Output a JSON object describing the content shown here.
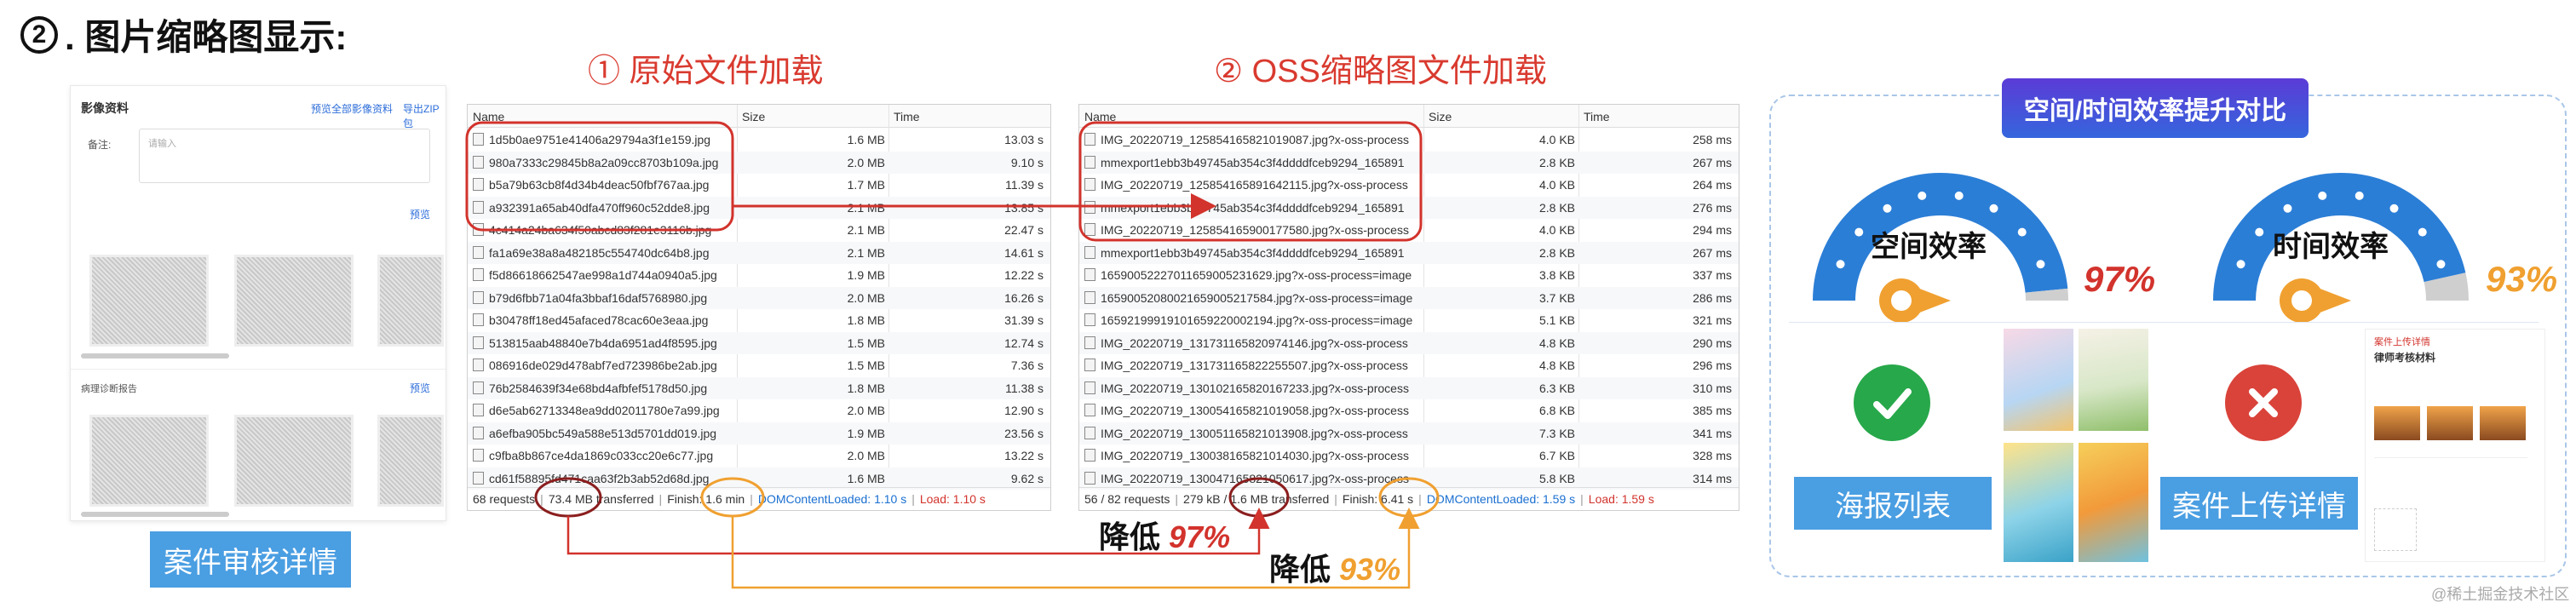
{
  "heading": {
    "num": "2",
    "text": ". 图片缩略图显示:"
  },
  "left_panel": {
    "title": "影像资料",
    "link1": "预览全部影像资料",
    "link2": "导出ZIP包",
    "note_label": "备注:",
    "note_placeholder": "请输入",
    "preview1": "预览",
    "section2": "病理诊断报告",
    "preview2": "预览",
    "button": "案件审核详情"
  },
  "title1": "① 原始文件加载",
  "title2": "② OSS缩略图文件加载",
  "table1": {
    "headers": [
      "Name",
      "Size",
      "Time"
    ],
    "rows": [
      [
        "1d5b0ae9751e41406a29794a3f1e159.jpg",
        "1.6 MB",
        "13.03 s"
      ],
      [
        "980a7333c29845b8a2a09cc8703b109a.jpg",
        "2.0 MB",
        "9.10 s"
      ],
      [
        "b5a79b63cb8f4d34b4deac50fbf767aa.jpg",
        "1.7 MB",
        "11.39 s"
      ],
      [
        "a932391a65ab40dfa470ff960c52dde8.jpg",
        "2.1 MB",
        "13.85 s"
      ],
      [
        "4c414a24ba634f50abcd83f281e3116b.jpg",
        "2.1 MB",
        "22.47 s"
      ],
      [
        "fa1a69e38a8a482185c554740dc64b8.jpg",
        "2.1 MB",
        "14.61 s"
      ],
      [
        "f5d86618662547ae998a1d744a0940a5.jpg",
        "1.9 MB",
        "12.22 s"
      ],
      [
        "b79d6fbb71a04fa3bbaf16daf5768980.jpg",
        "2.0 MB",
        "16.26 s"
      ],
      [
        "b30478ff18ed45afaced78cac60e3eaa.jpg",
        "1.8 MB",
        "31.39 s"
      ],
      [
        "513815aab48840e7b4da6951ad4f8595.jpg",
        "1.5 MB",
        "12.74 s"
      ],
      [
        "086916de029d478abf7ed723986be2ab.jpg",
        "1.5 MB",
        "7.36 s"
      ],
      [
        "76b2584639f34e68bd4afbfef5178d50.jpg",
        "1.8 MB",
        "11.38 s"
      ],
      [
        "d6e5ab62713348ea9dd02011780e7a99.jpg",
        "2.0 MB",
        "12.90 s"
      ],
      [
        "a6efba905bc549a588e513d5701dd019.jpg",
        "1.9 MB",
        "23.56 s"
      ],
      [
        "c9fba8b867ce4da1869c033cc20e6c77.jpg",
        "2.0 MB",
        "13.22 s"
      ],
      [
        "cd61f58895fd471caa63f2b3ab52d68d.jpg",
        "1.6 MB",
        "9.62 s"
      ]
    ],
    "foot_requests": "68 requests",
    "foot_size": "73.4 MB",
    "foot_transferred": "transferred",
    "foot_finish": "Finish: 1.6 min",
    "foot_dom": "DOMContentLoaded: 1.10 s",
    "foot_load": "Load: 1.10 s"
  },
  "table2": {
    "headers": [
      "Name",
      "Size",
      "Time"
    ],
    "rows": [
      [
        "IMG_20220719_125854165821019087.jpg?x-oss-process",
        "4.0 KB",
        "258 ms"
      ],
      [
        "mmexport1ebb3b49745ab354c3f4ddddfceb9294_165891",
        "2.8 KB",
        "267 ms"
      ],
      [
        "IMG_20220719_125854165891642115.jpg?x-oss-process",
        "4.0 KB",
        "264 ms"
      ],
      [
        "mmexport1ebb3b49745ab354c3f4ddddfceb9294_165891",
        "2.8 KB",
        "276 ms"
      ],
      [
        "IMG_20220719_125854165900177580.jpg?x-oss-process",
        "4.0 KB",
        "294 ms"
      ],
      [
        "mmexport1ebb3b49745ab354c3f4ddddfceb9294_165891",
        "2.8 KB",
        "267 ms"
      ],
      [
        "16590052227011659005231629.jpg?x-oss-process=image",
        "3.8 KB",
        "337 ms"
      ],
      [
        "16590052080021659005217584.jpg?x-oss-process=image",
        "3.7 KB",
        "286 ms"
      ],
      [
        "16592199919101659220002194.jpg?x-oss-process=image",
        "5.1 KB",
        "321 ms"
      ],
      [
        "IMG_20220719_131731165820974146.jpg?x-oss-process",
        "4.8 KB",
        "290 ms"
      ],
      [
        "IMG_20220719_131731165822255507.jpg?x-oss-process",
        "4.8 KB",
        "296 ms"
      ],
      [
        "IMG_20220719_130102165820167233.jpg?x-oss-process",
        "6.3 KB",
        "310 ms"
      ],
      [
        "IMG_20220719_130054165821019058.jpg?x-oss-process",
        "6.8 KB",
        "385 ms"
      ],
      [
        "IMG_20220719_130051165821013908.jpg?x-oss-process",
        "7.3 KB",
        "341 ms"
      ],
      [
        "IMG_20220719_130038165821014030.jpg?x-oss-process",
        "6.7 KB",
        "328 ms"
      ],
      [
        "IMG_20220719_130047165821050617.jpg?x-oss-process",
        "5.8 KB",
        "314 ms"
      ]
    ],
    "foot_requests": "56 / 82 requests",
    "foot_kb": "279 kB /",
    "foot_size": "1.6 MB",
    "foot_transferred": "transferred",
    "foot_finish": "Finish: 6.41 s",
    "foot_dom": "DOMContentLoaded: 1.59 s",
    "foot_load": "Load: 1.59 s"
  },
  "reduce1": {
    "label": "降低",
    "pct": "97%"
  },
  "reduce2": {
    "label": "降低",
    "pct": "93%"
  },
  "right": {
    "badge": "空间/时间效率提升对比",
    "gauge1": {
      "title": "空间效率",
      "pct": "97%",
      "value": 97
    },
    "gauge2": {
      "title": "时间效率",
      "pct": "93%",
      "value": 93
    },
    "btn_left": "海报列表",
    "btn_right": "案件上传详情",
    "mini_title": "案件上传详情",
    "mini_sub": "律师考核材料"
  },
  "colors": {
    "red": "#d2332c",
    "orange": "#f0a030",
    "blue": "#2b7ed6",
    "green": "#27a84a"
  },
  "watermark": "@稀土掘金技术社区"
}
